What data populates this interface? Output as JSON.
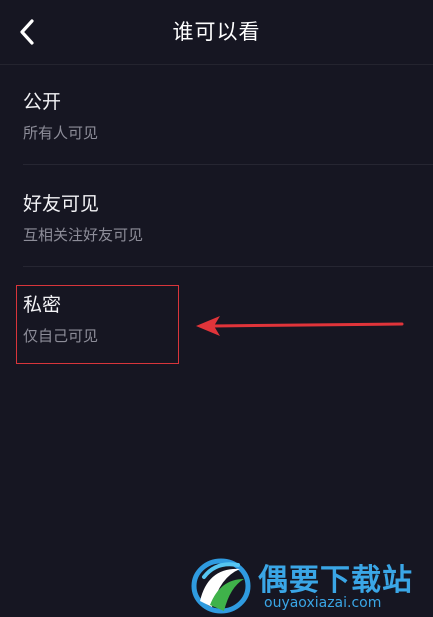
{
  "header": {
    "title": "谁可以看",
    "back_icon": "chevron-left-icon"
  },
  "options": [
    {
      "label": "公开",
      "description": "所有人可见"
    },
    {
      "label": "好友可见",
      "description": "互相关注好友可见"
    },
    {
      "label": "私密",
      "description": "仅自己可见"
    }
  ],
  "annotation": {
    "highlight_color": "#d8353b",
    "arrow_color": "#e0343a",
    "highlighted_option": "私密"
  },
  "watermark": {
    "name": "偶要下载站",
    "domain": "ouyaoxiazai.com",
    "color": "#3aa6e6"
  },
  "theme": {
    "background": "#161622",
    "text_primary": "#f2f2f5",
    "text_secondary": "#8d8d99"
  }
}
